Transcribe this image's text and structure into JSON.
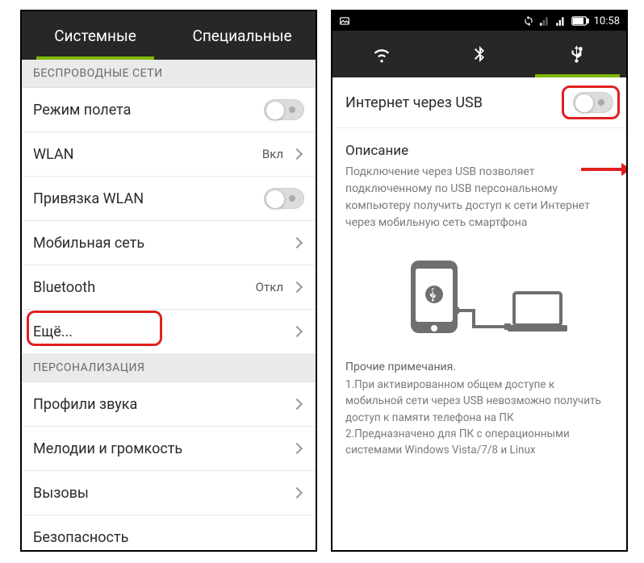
{
  "left": {
    "tabs": {
      "system": "Системные",
      "special": "Специальные"
    },
    "section_wireless": "БЕСПРОВОДНЫЕ СЕТИ",
    "rows": {
      "airplane": "Режим полета",
      "wlan": "WLAN",
      "wlan_status": "Вкл",
      "wlan_tether": "Привязка WLAN",
      "mobile": "Мобильная сеть",
      "bluetooth": "Bluetooth",
      "bluetooth_status": "Откл",
      "more": "Ещё..."
    },
    "section_personal": "ПЕРСОНАЛИЗАЦИЯ",
    "rows2": {
      "sound_profiles": "Профили звука",
      "melodies": "Мелодии и громкость",
      "calls": "Вызовы",
      "security": "Безопасность"
    }
  },
  "right": {
    "status_time": "10:58",
    "usb_label": "Интернет через USB",
    "desc_title": "Описание",
    "desc_text": "Подключение через USB позволяет подключенному по USB персональному компьютеру получить доступ к сети Интернет через мобильную сеть смартфона",
    "notes_title": "Прочие примечания.",
    "note1": "1.При активированном общем доступе к мобильной сети через USB невозможно получить доступ к памяти телефона на ПК",
    "note2": "2.Предназначено для ПК с операционными системами Windows Vista/7/8 и Linux"
  }
}
